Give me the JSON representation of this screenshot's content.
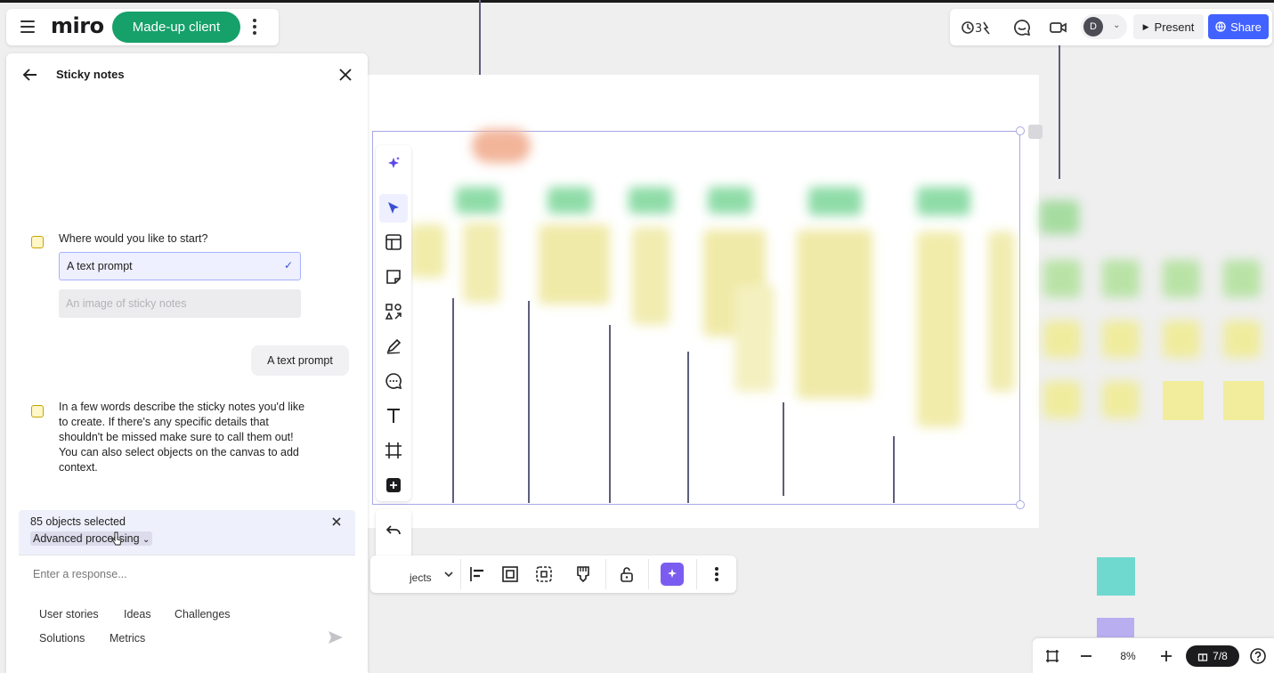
{
  "app": {
    "logo": "miro",
    "client_name": "Made-up client"
  },
  "header_right": {
    "avatar_initial": "D",
    "present_label": "Present",
    "share_label": "Share",
    "accent_color": "#4262ff",
    "client_color": "#16a06a"
  },
  "panel": {
    "title": "Sticky notes",
    "question_1": "Where would you like to start?",
    "options": [
      {
        "label": "A text prompt",
        "selected": true
      },
      {
        "label": "An image of sticky notes",
        "selected": false
      }
    ],
    "user_reply": "A text prompt",
    "instruction": "In a few words describe the sticky notes you'd like to create. If there's any specific details that shouldn't be missed make sure to call them out! You can also select objects on the canvas to add context.",
    "selection_count": "85 objects selected",
    "processing_label": "Advanced processing",
    "response_placeholder": "Enter a response...",
    "suggestions": [
      "User stories",
      "Ideas",
      "Challenges",
      "Solutions",
      "Metrics"
    ]
  },
  "context_toolbar": {
    "label": "jects"
  },
  "zoom": {
    "level": "8%",
    "page_indicator": "7/8"
  },
  "toolbar_icons": [
    "sparkle-icon",
    "select-cursor-icon",
    "templates-icon",
    "sticky-note-icon",
    "shapes-icon",
    "pen-icon",
    "comment-icon",
    "text-icon",
    "frame-icon",
    "more-apps-icon",
    "undo-icon",
    "redo-icon"
  ]
}
